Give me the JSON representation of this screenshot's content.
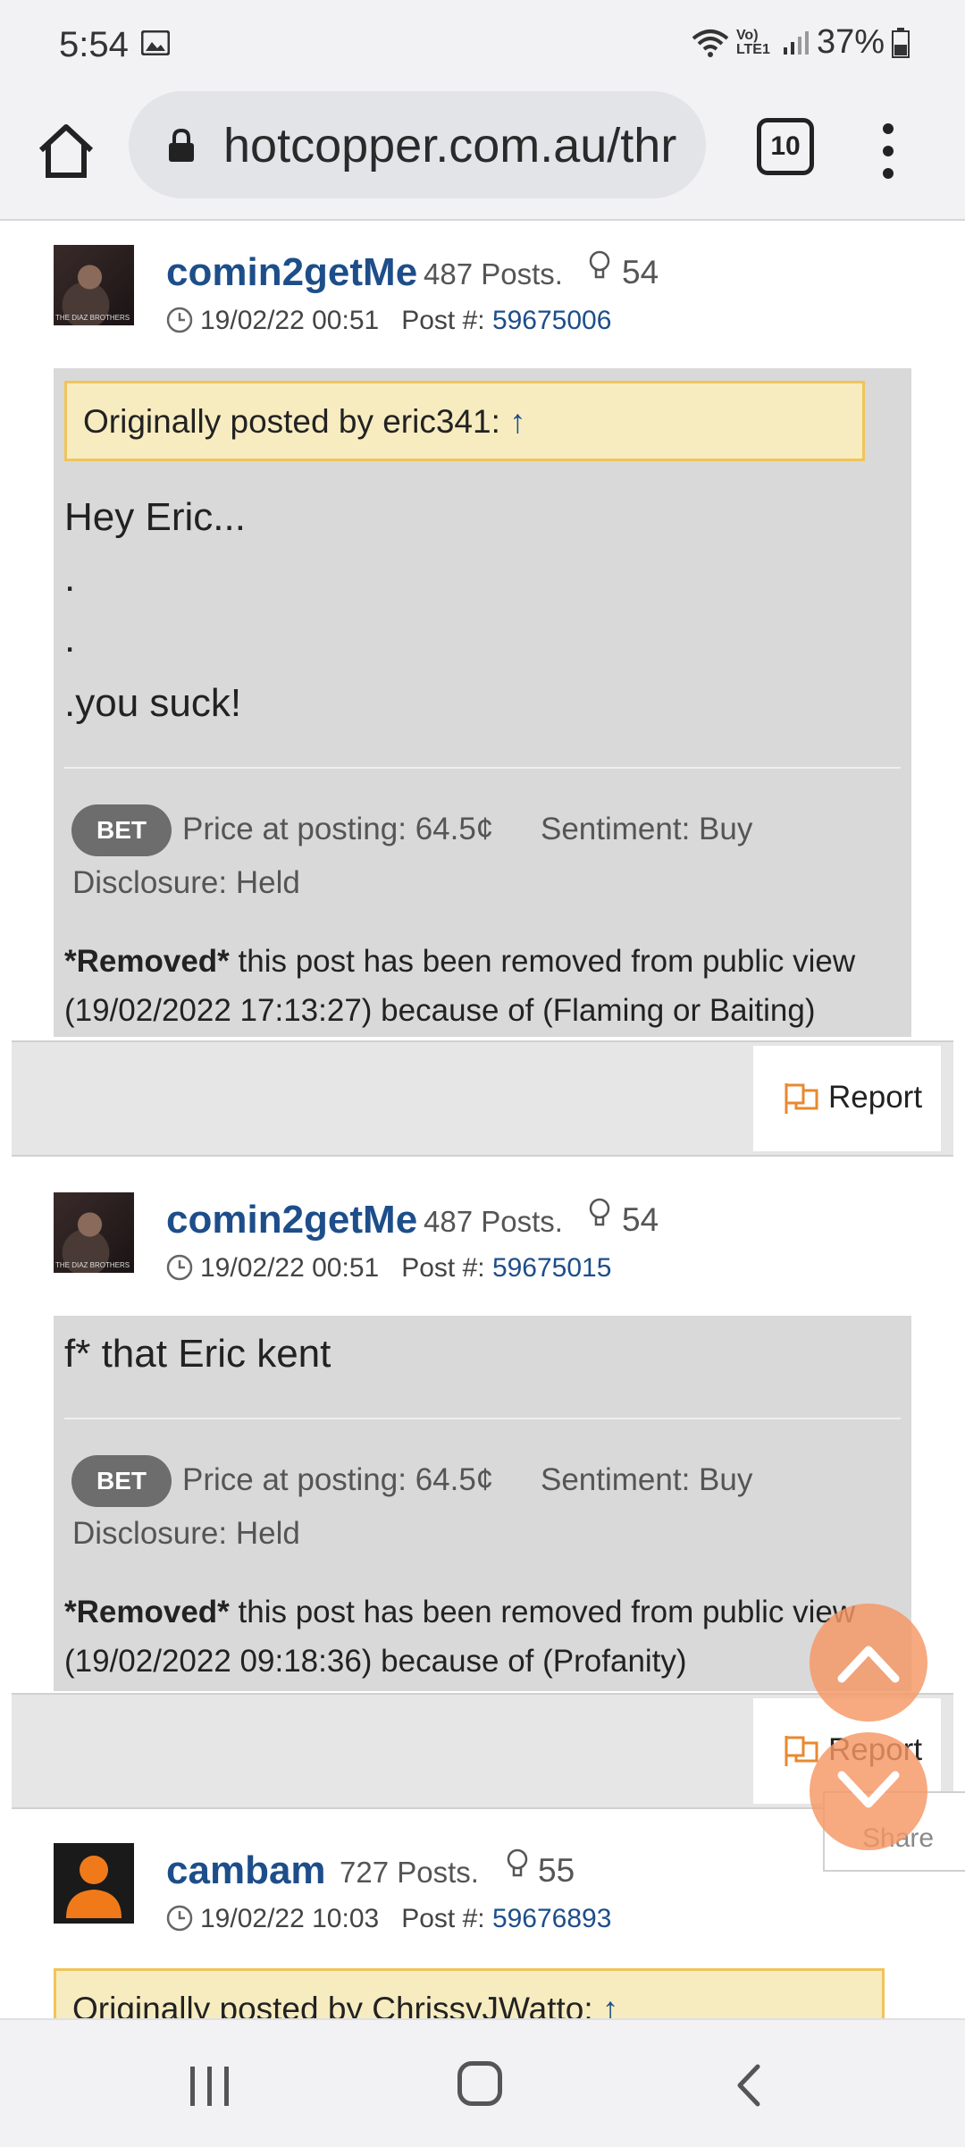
{
  "status_bar": {
    "time": "5:54",
    "network": "Vo) LTE1",
    "battery": "37%"
  },
  "browser": {
    "url": "hotcopper.com.au/thr",
    "tab_count": "10"
  },
  "posts": [
    {
      "username": "comin2getMe",
      "posts_count": "487 Posts.",
      "likes": "54",
      "date": "19/02/22 00:51",
      "post_label": "Post #:",
      "post_number": "59675006",
      "avatar_caption": "THE DIAZ BROTHERS",
      "quote": {
        "prefix": "Originally posted by eric341:",
        "arrow": "↑"
      },
      "body_lines": [
        "Hey Eric...",
        ".",
        ".",
        ".you suck!"
      ],
      "badge": "BET",
      "price": "Price at posting: 64.5¢",
      "sentiment": "Sentiment: Buy",
      "disclosure": "Disclosure: Held",
      "removed_bold": "*Removed*",
      "removed_text": " this post has been removed from public view (19/02/2022 17:13:27) because of (Flaming or Baiting)",
      "report": "Report"
    },
    {
      "username": "comin2getMe",
      "posts_count": "487 Posts.",
      "likes": "54",
      "date": "19/02/22 00:51",
      "post_label": "Post #:",
      "post_number": "59675015",
      "avatar_caption": "THE DIAZ BROTHERS",
      "body_lines": [
        "f* that Eric kent"
      ],
      "badge": "BET",
      "price": "Price at posting: 64.5¢",
      "sentiment": "Sentiment: Buy",
      "disclosure": "Disclosure: Held",
      "removed_bold": "*Removed*",
      "removed_text": " this post has been removed from public view (19/02/2022 09:18:36) because of (Profanity)",
      "report": "Report"
    },
    {
      "username": "cambam",
      "posts_count": "727 Posts.",
      "likes": "55",
      "date": "19/02/22 10:03",
      "post_label": "Post #:",
      "post_number": "59676893",
      "quote": {
        "prefix": "Originally posted by ChrissyJWatto:",
        "arrow": "↑"
      }
    }
  ],
  "floating": {
    "share": "Share"
  },
  "colors": {
    "username": "#1d4e8a",
    "quote_bg": "#f7ecc0",
    "quote_border": "#f0c45a",
    "fab": "#f5966a",
    "report_flag": "#e8892f"
  }
}
